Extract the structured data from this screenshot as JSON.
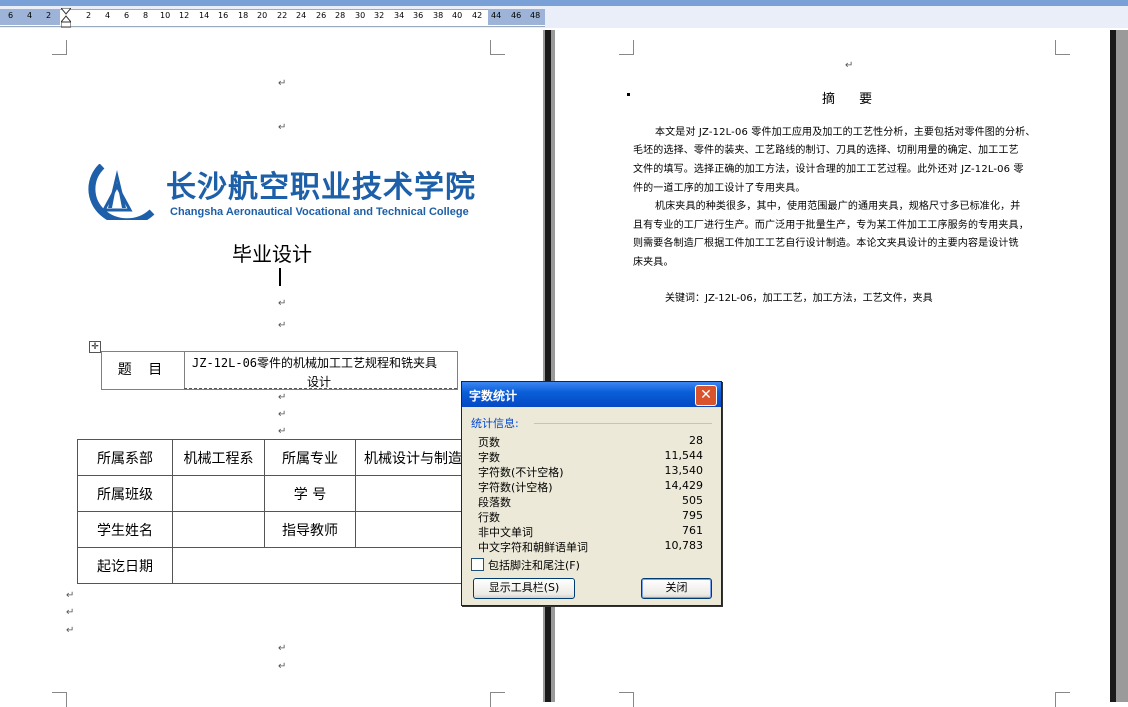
{
  "ruler": {
    "ticks": [
      "6",
      "4",
      "2",
      "2",
      "4",
      "6",
      "8",
      "10",
      "12",
      "14",
      "16",
      "18",
      "20",
      "22",
      "24",
      "26",
      "28",
      "30",
      "32",
      "34",
      "36",
      "38",
      "40",
      "42",
      "44",
      "46",
      "48"
    ]
  },
  "logo": {
    "chinese": "长沙航空职业技术学院",
    "english": "Changsha Aeronautical Vocational and Technical College"
  },
  "document": {
    "title": "毕业设计",
    "topic_label": "题  目",
    "topic_line1": "JZ-12L-06零件的机械加工工艺规程和铣夹具",
    "topic_line2": "设计",
    "info_table": {
      "department_label": "所属系部",
      "department_value": "机械工程系",
      "major_label": "所属专业",
      "major_value": "机械设计与制造",
      "class_label": "所属班级",
      "student_id_label": "学  号",
      "student_name_label": "学生姓名",
      "advisor_label": "指导教师",
      "dates_label": "起讫日期"
    }
  },
  "abstract": {
    "title": "摘  要",
    "lines": [
      "本文是对 JZ-12L-06 零件加工应用及加工的工艺性分析，主要包括对零件图的分析、",
      "毛坯的选择、零件的装夹、工艺路线的制订、刀具的选择、切削用量的确定、加工工艺",
      "文件的填写。选择正确的加工方法，设计合理的加工工艺过程。此外还对 JZ-12L-06 零",
      "件的一道工序的加工设计了专用夹具。",
      "机床夹具的种类很多，其中，使用范围最广的通用夹具，规格尺寸多已标准化，并",
      "且有专业的工厂进行生产。而广泛用于批量生产，专为某工件加工工序服务的专用夹具，",
      "则需要各制造厂根据工件加工工艺自行设计制造。本论文夹具设计的主要内容是设计铣",
      "床夹具。"
    ],
    "keywords": "关键词：JZ-12L-06，加工工艺，加工方法，工艺文件，夹具"
  },
  "dialog": {
    "title": "字数统计",
    "group_label": "统计信息:",
    "stats": [
      {
        "label": "页数",
        "value": "28"
      },
      {
        "label": "字数",
        "value": "11,544"
      },
      {
        "label": "字符数(不计空格)",
        "value": "13,540"
      },
      {
        "label": "字符数(计空格)",
        "value": "14,429"
      },
      {
        "label": "段落数",
        "value": "505"
      },
      {
        "label": "行数",
        "value": "795"
      },
      {
        "label": "非中文单词",
        "value": "761"
      },
      {
        "label": "中文字符和朝鲜语单词",
        "value": "10,783"
      }
    ],
    "checkbox_label": "包括脚注和尾注(F)",
    "checkbox_checked": false,
    "toolbar_button": "显示工具栏(S)",
    "close_button": "关闭",
    "close_glyph": "✕"
  },
  "paragraph_mark": "↵",
  "colors": {
    "logo_blue": "#1d5fa8",
    "titlebar_blue": "#0a5fd8",
    "close_red": "#d9542c",
    "dialog_face": "#ece9d8"
  }
}
